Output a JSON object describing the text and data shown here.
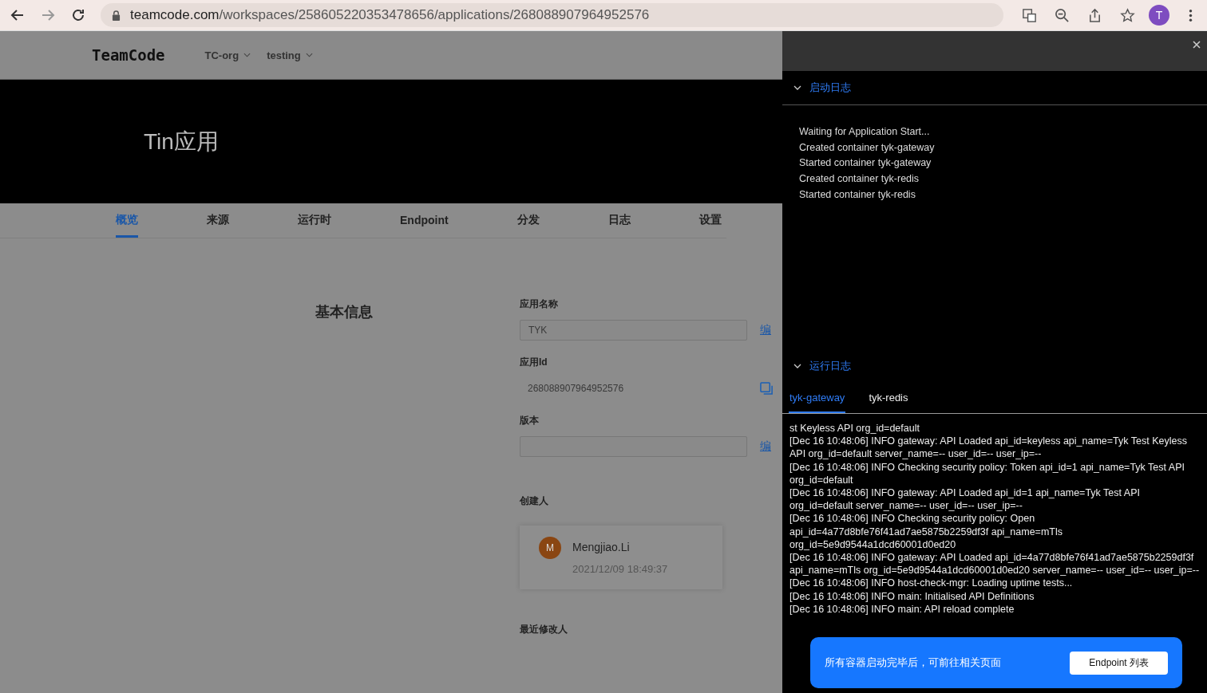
{
  "browser": {
    "url_host": "teamcode.com",
    "url_path": "/workspaces/258605220353478656/applications/268088907964952576",
    "avatar": "T"
  },
  "header": {
    "logo": "TeamCode",
    "dropdowns": [
      "TC-org",
      "testing"
    ]
  },
  "hero_title": "Tin应用",
  "tabs": [
    {
      "label": "概览",
      "selected": true
    },
    {
      "label": "来源",
      "selected": false
    },
    {
      "label": "运行时",
      "selected": false
    },
    {
      "label": "Endpoint",
      "selected": false
    },
    {
      "label": "分发",
      "selected": false
    },
    {
      "label": "日志",
      "selected": false
    },
    {
      "label": "设置",
      "selected": false
    }
  ],
  "section_title": "基本信息",
  "fields": [
    {
      "kind": "input",
      "label": "应用名称",
      "value": "TYK",
      "action": "编"
    },
    {
      "kind": "copy",
      "label": "应用Id",
      "value": "268088907964952576"
    },
    {
      "kind": "input",
      "label": "版本",
      "action": "编"
    }
  ],
  "creator": {
    "label": "创建人",
    "initial": "M",
    "name": "Mengjiao.Li",
    "time": "2021/12/09 18:49:37"
  },
  "modifier_label": "最近修改人",
  "drawer": {
    "startup": {
      "title": "启动日志",
      "expanded": true,
      "lines": [
        "Waiting for Application Start...",
        "Created container tyk-gateway",
        "Started container tyk-gateway",
        "Created container tyk-redis",
        "Started container tyk-redis"
      ]
    },
    "runtime": {
      "title": "运行日志",
      "expanded": true,
      "tabs": [
        {
          "label": "tyk-gateway",
          "selected": true
        },
        {
          "label": "tyk-redis",
          "selected": false
        }
      ],
      "lines": [
        "st Keyless API org_id=default",
        "[Dec 16 10:48:06] INFO gateway: API Loaded api_id=keyless api_name=Tyk Test Keyless API org_id=default server_name=-- user_id=-- user_ip=--",
        "[Dec 16 10:48:06] INFO Checking security policy: Token api_id=1 api_name=Tyk Test API org_id=default",
        "[Dec 16 10:48:06] INFO gateway: API Loaded api_id=1 api_name=Tyk Test API org_id=default server_name=-- user_id=-- user_ip=--",
        "[Dec 16 10:48:06] INFO Checking security policy: Open api_id=4a77d8bfe76f41ad7ae5875b2259df3f api_name=mTls org_id=5e9d9544a1dcd60001d0ed20",
        "[Dec 16 10:48:06] INFO gateway: API Loaded api_id=4a77d8bfe76f41ad7ae5875b2259df3f api_name=mTls org_id=5e9d9544a1dcd60001d0ed20 server_name=-- user_id=-- user_ip=--",
        "[Dec 16 10:48:06] INFO host-check-mgr: Loading uptime tests...",
        "[Dec 16 10:48:06] INFO main: Initialised API Definitions",
        "[Dec 16 10:48:06] INFO main: API reload complete"
      ]
    },
    "banner": {
      "text": "所有容器启动完毕后，可前往相关页面",
      "button": "Endpoint 列表"
    }
  }
}
